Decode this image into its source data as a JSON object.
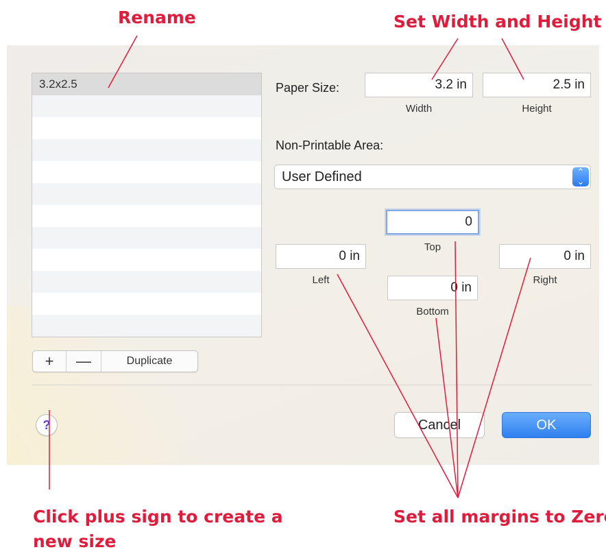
{
  "annotations": {
    "rename": "Rename",
    "set_width_height": "Set Width and Height",
    "plus_sign": "Click plus sign to create a new size",
    "margins_zero": "Set all margins to Zero"
  },
  "list": {
    "selected_item": "3.2x2.5"
  },
  "list_controls": {
    "plus": "+",
    "minus": "—",
    "duplicate": "Duplicate"
  },
  "paper_size": {
    "label": "Paper Size:",
    "width_value": "3.2 in",
    "height_value": "2.5 in",
    "width_label": "Width",
    "height_label": "Height"
  },
  "non_printable": {
    "label": "Non-Printable Area:",
    "selected": "User Defined",
    "top_value": "0",
    "top_label": "Top",
    "left_value": "0 in",
    "left_label": "Left",
    "right_value": "0 in",
    "right_label": "Right",
    "bottom_value": "0 in",
    "bottom_label": "Bottom"
  },
  "footer": {
    "help": "?",
    "cancel": "Cancel",
    "ok": "OK"
  },
  "colors": {
    "annotation": "#e01c3c",
    "accent": "#2f7ff0"
  }
}
